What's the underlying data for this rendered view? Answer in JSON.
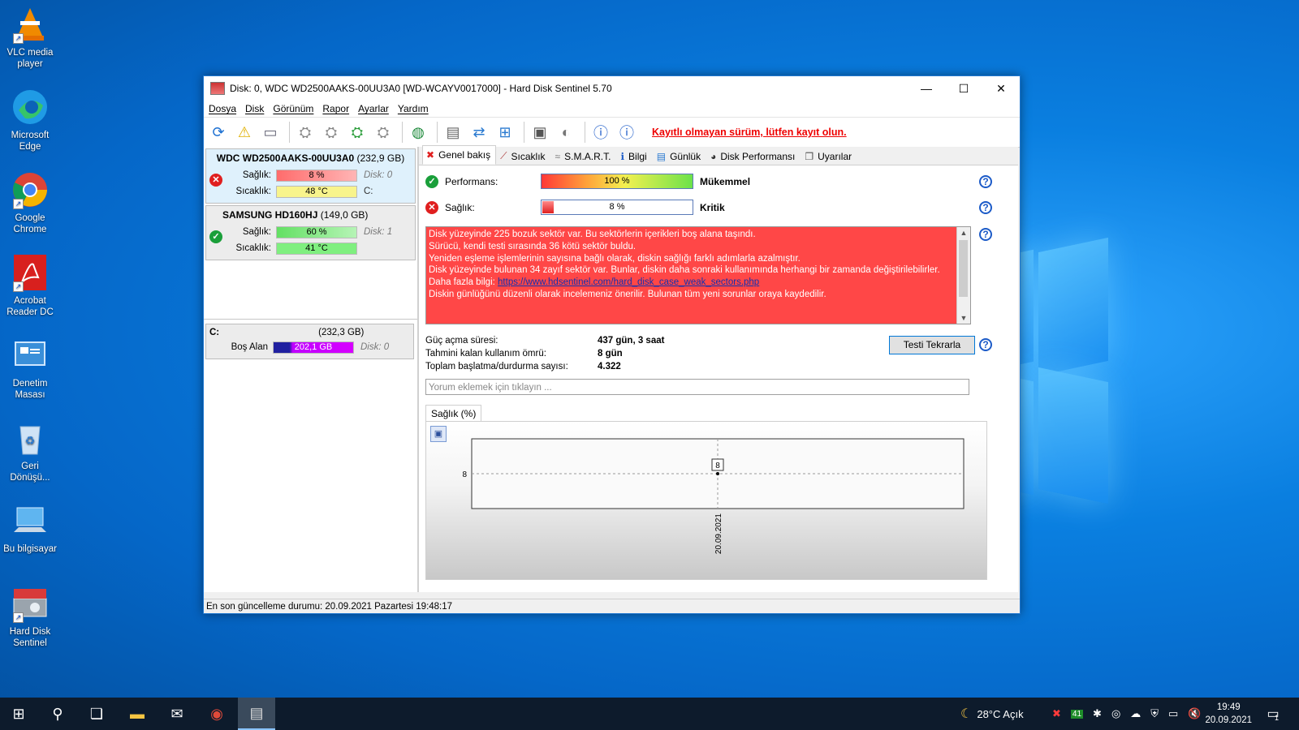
{
  "desktop": {
    "icons": [
      {
        "label": "VLC media player",
        "icon": "vlc-icon"
      },
      {
        "label": "Microsoft Edge",
        "icon": "edge-icon"
      },
      {
        "label": "Google Chrome",
        "icon": "chrome-icon"
      },
      {
        "label": "Acrobat Reader DC",
        "icon": "acrobat-icon"
      },
      {
        "label": "Denetim Masası",
        "icon": "control-panel-icon"
      },
      {
        "label": "Geri Dönüşü...",
        "icon": "recycle-bin-icon"
      },
      {
        "label": "Bu bilgisayar",
        "icon": "computer-icon"
      },
      {
        "label": "Hard Disk Sentinel",
        "icon": "hdsentinel-icon"
      }
    ]
  },
  "window": {
    "title": "Disk: 0, WDC WD2500AAKS-00UU3A0 [WD-WCAYV0017000]  -  Hard Disk Sentinel 5.70",
    "controls": {
      "minimize": "—",
      "maximize": "☐",
      "close": "✕"
    }
  },
  "menu": [
    "Dosya",
    "Disk",
    "Görünüm",
    "Rapor",
    "Ayarlar",
    "Yardım"
  ],
  "toolbar": {
    "unregistered_text": "Kayıtlı olmayan sürüm, lütfen kayıt olun."
  },
  "disks": [
    {
      "name": "WDC WD2500AAKS-00UU3A0",
      "size": "(232,9 GB)",
      "status": "error",
      "health_label": "Sağlık:",
      "health": "8 %",
      "health_extra": "Disk: 0",
      "temp_label": "Sıcaklık:",
      "temp": "48 °C",
      "temp_extra": "C:"
    },
    {
      "name": "SAMSUNG HD160HJ",
      "size": "(149,0 GB)",
      "status": "ok",
      "health_label": "Sağlık:",
      "health": "60 %",
      "health_extra": "Disk: 1",
      "temp_label": "Sıcaklık:",
      "temp": "41 °C",
      "temp_extra": ""
    }
  ],
  "volume": {
    "name": "C:",
    "size": "(232,3 GB)",
    "free_label": "Boş Alan",
    "free": "202,1 GB",
    "disk": "Disk: 0"
  },
  "tabs": [
    "Genel bakış",
    "Sıcaklık",
    "S.M.A.R.T.",
    "Bilgi",
    "Günlük",
    "Disk Performansı",
    "Uyarılar"
  ],
  "overview": {
    "performance_label": "Performans:",
    "performance_value": "100 %",
    "performance_rating": "Mükemmel",
    "health_label": "Sağlık:",
    "health_value": "8 %",
    "health_rating": "Kritik",
    "messages": [
      "Disk yüzeyinde 225 bozuk sektör var. Bu sektörlerin içerikleri boş alana taşındı.",
      "Sürücü, kendi testi sırasında 36 kötü sektör buldu.",
      "Yeniden eşleme işlemlerinin sayısına bağlı olarak, diskin sağlığı farklı adımlarla azalmıştır.",
      "Disk yüzeyinde bulunan 34 zayıf sektör var. Bunlar, diskin daha sonraki kullanımında herhangi bir zamanda değiştirilebilirler."
    ],
    "more_info_label": "Daha fazla bilgi:",
    "more_info_link": "https://www.hdsentinel.com/hard_disk_case_weak_sectors.php",
    "last_message": "Diskin günlüğünü düzenli olarak incelemeniz önerilir. Bulunan tüm yeni sorunlar oraya kaydedilir.",
    "power_on_label": "Güç açma süresi:",
    "power_on_value": "437 gün, 3 saat",
    "lifetime_label": "Tahmini kalan kullanım ömrü:",
    "lifetime_value": "8 gün",
    "startstop_label": "Toplam başlatma/durdurma sayısı:",
    "startstop_value": "4.322",
    "retest_button": "Testi Tekrarla",
    "comment_placeholder": "Yorum eklemek için tıklayın ..."
  },
  "chart_tab": "Sağlık (%)",
  "chart_data": {
    "type": "line",
    "x": [
      "20.09.2021"
    ],
    "series": [
      {
        "values": [
          8
        ]
      }
    ],
    "title": "Sağlık (%)",
    "y_tick_label": "8",
    "data_labels": [
      "8"
    ],
    "grid": true
  },
  "statusbar": "En son güncelleme durumu: 20.09.2021 Pazartesi 19:48:17",
  "taskbar": {
    "weather": "28°C  Açık",
    "time": "19:49",
    "date": "20.09.2021",
    "tray_badge": "41",
    "notif_count": "1"
  },
  "colors": {
    "health_critical": "#ff4747",
    "ok_green": "#1a9f3a",
    "free_space": "#c000ff"
  }
}
